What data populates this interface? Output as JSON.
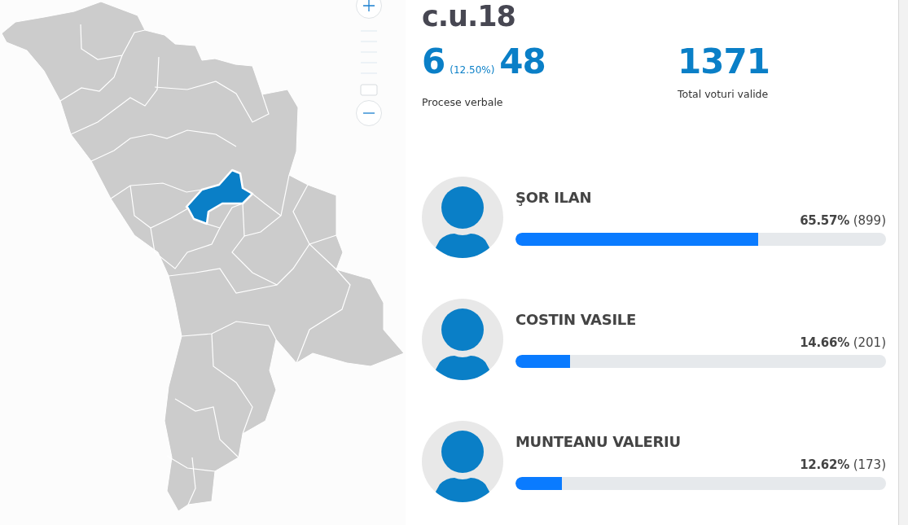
{
  "zoom": {
    "level": 0
  },
  "constituency": {
    "title": "c.u.18"
  },
  "stats": [
    {
      "kind": "ratio",
      "value": "6",
      "percent": "(12.50%)",
      "total": "48",
      "label": "Procese verbale"
    },
    {
      "kind": "single",
      "value": "1371",
      "label": "Total voturi valide"
    }
  ],
  "candidates": [
    {
      "name": "ŞOR ILAN",
      "percent": "65.57%",
      "votes": "(899)",
      "level": 0.6557
    },
    {
      "name": "COSTIN VASILE",
      "percent": "14.66%",
      "votes": "(201)",
      "level": 0.1466
    },
    {
      "name": "MUNTEANU VALERIU",
      "percent": "12.62%",
      "votes": "(173)",
      "level": 0.1262
    }
  ]
}
